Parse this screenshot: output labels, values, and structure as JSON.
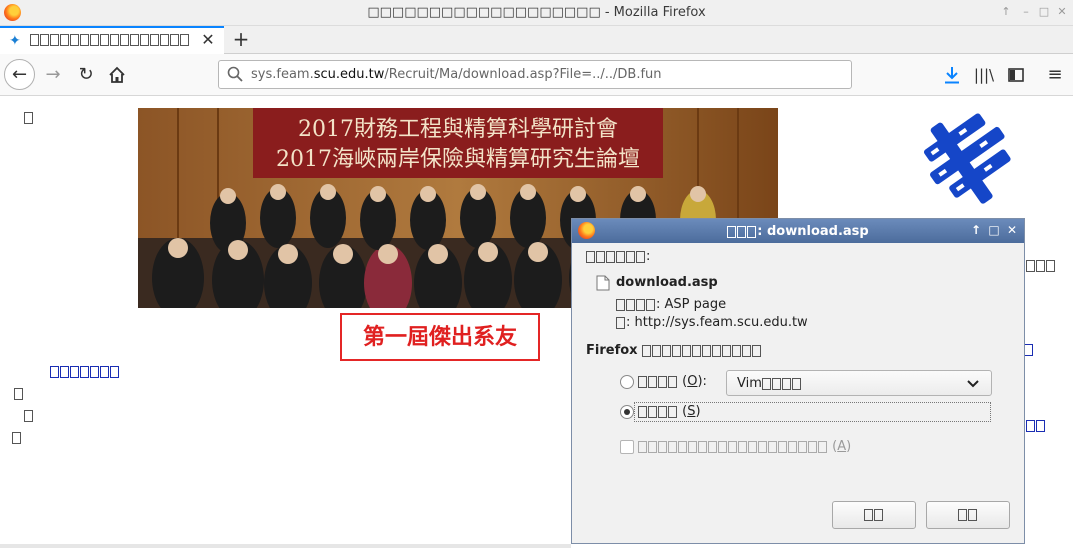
{
  "window": {
    "title": "□□□□□□□□□□□□□□□□□□□ - Mozilla Firefox",
    "controls": [
      "minimize",
      "maximize",
      "close"
    ]
  },
  "tab": {
    "label": "□□□□□□□□□□□□□□□□□",
    "favicon": "feam-favicon"
  },
  "navbar": {
    "url_prefix": "sys.feam.",
    "url_domain": "scu.edu.tw",
    "url_path": "/Recruit/Ma/download.asp?File=../../DB.fun"
  },
  "page": {
    "photo_line1": "2017財務工程與精算科學研討會",
    "photo_line2": "2017海峽兩岸保險與精算研究生論壇",
    "caption": "第一屆傑出系友"
  },
  "dialog": {
    "title_suffix": ": download.asp",
    "filename": "download.asp",
    "type_value": ": ASP page",
    "from_value": ": http://sys.feam.scu.edu.tw",
    "firefox_prompt": "Firefox",
    "open_with_key": "(O):",
    "open_with_key_letter": "O",
    "app_selected": "Vim",
    "save_key_letter": "S",
    "remember_key_letter": "A"
  },
  "colors": {
    "accent": "#0a84ff",
    "dialog_title": "#5a7aaa",
    "caption_red": "#e02020",
    "logo_blue": "#1546c8"
  }
}
